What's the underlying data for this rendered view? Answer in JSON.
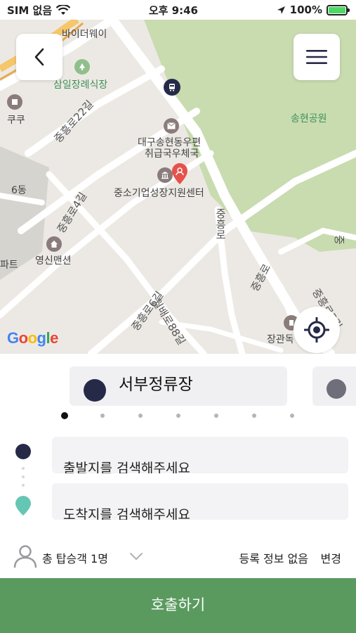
{
  "status_bar": {
    "carrier": "SIM 없음",
    "time": "오후 9:46",
    "battery": "100%"
  },
  "map": {
    "labels": {
      "by_the_way": "바이더웨이",
      "samil": "삼일장례식장",
      "kuku": "쿠쿠",
      "jungheung22": "중흥로22길",
      "post_office_1": "대구송현동우편",
      "post_office_2": "취급국우체국",
      "sme_center": "중소기업성장지원센터",
      "songhyeon_park": "송현공원",
      "dong6": "6동",
      "jungheung4": "중흥로4길",
      "jungheung_v": "중흥로",
      "jungheung_main": "중흥로",
      "jungheung6": "중흥로6길",
      "wolbae88": "월배로88길",
      "jungheung5": "중흥로5길",
      "jang": "중",
      "yeongsin": "영신맨션",
      "apart": "파트",
      "janggwan": "장관독"
    },
    "google": [
      "G",
      "o",
      "o",
      "g",
      "l",
      "e"
    ]
  },
  "carousel": {
    "current_station": "서부정류장",
    "page_count": 7,
    "active_page": 0
  },
  "route": {
    "from_placeholder": "출발지를 검색해주세요",
    "to_placeholder": "도착지를 검색해주세요"
  },
  "passenger": {
    "label": "총 탑승객 1명",
    "registration": "등록 정보 없음",
    "change": "변경"
  },
  "call_button": "호출하기",
  "colors": {
    "navy": "#262a48",
    "teal": "#66c6b4",
    "call_green": "#5a9a5f",
    "park_green": "#c8dcb0"
  }
}
